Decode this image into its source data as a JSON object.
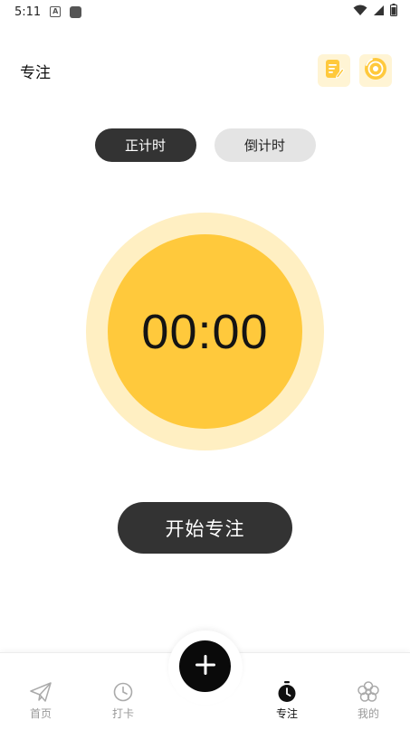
{
  "status_bar": {
    "time": "5:11",
    "notif_letter": "A"
  },
  "header": {
    "title": "专注"
  },
  "mode_toggle": {
    "count_up": "正计时",
    "count_down": "倒计时",
    "selected": "count_up"
  },
  "timer": {
    "display": "00:00"
  },
  "start_button": {
    "label": "开始专注"
  },
  "bottom_nav": {
    "items": [
      {
        "label": "首页",
        "icon": "paper-plane-icon",
        "active": false
      },
      {
        "label": "打卡",
        "icon": "clock-icon",
        "active": false
      },
      {
        "label": "专注",
        "icon": "stopwatch-icon",
        "active": true
      },
      {
        "label": "我的",
        "icon": "flower-icon",
        "active": false
      }
    ],
    "fab_icon": "plus-icon"
  },
  "colors": {
    "accent_yellow": "#ffc93c",
    "ring_yellow": "#ffefc2",
    "dark": "#333333",
    "inactive_gray": "#e4e4e4",
    "nav_inactive": "#999999"
  }
}
